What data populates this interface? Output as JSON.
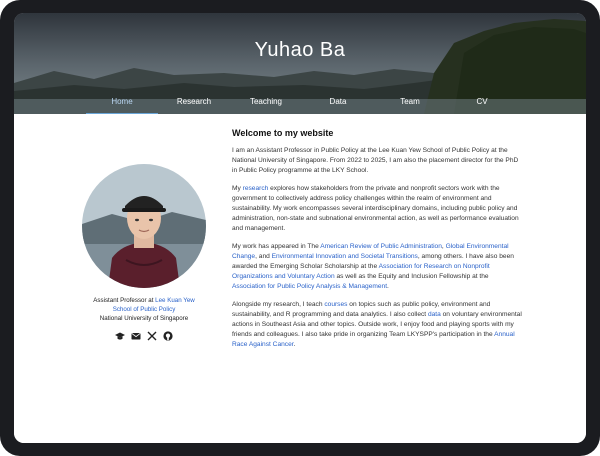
{
  "site": {
    "title": "Yuhao Ba"
  },
  "nav": [
    "Home",
    "Research",
    "Teaching",
    "Data",
    "Team",
    "CV"
  ],
  "sidebar": {
    "line1_prefix": "Assistant Professor at ",
    "line1_link": "Lee Kuan Yew",
    "line2_link": "School of Public Policy",
    "line3": "National University of Singapore",
    "icons": [
      "graduation-cap-icon",
      "email-icon",
      "x-icon",
      "github-icon"
    ]
  },
  "main": {
    "heading": "Welcome to my website",
    "p1": "I am an Assistant Professor in Public Policy at the Lee Kuan Yew School of Public Policy at the National University of Singapore. From 2022 to 2025, I am also the placement director for the PhD in Public Policy programme at the LKY School.",
    "p2a": "My ",
    "p2_link": "research",
    "p2b": " explores how stakeholders from the private and nonprofit sectors work with the government to collectively address policy challenges within the realm of environment and sustainability. My work encompasses several interdisciplinary domains, including public policy and administration, non-state and subnational environmental action, as well as performance evaluation and management.",
    "p3a": "My work has appeared in The ",
    "p3_link1": "American Review of Public Administration",
    "p3b": ", ",
    "p3_link2": "Global Environmental Change",
    "p3c": ", and ",
    "p3_link3": "Environmental Innovation and Societal Transitions",
    "p3d": ", among others. I have also been awarded the Emerging Scholar Scholarship at the ",
    "p3_link4": "Association for Research on Nonprofit Organizations and Voluntary Action",
    "p3e": " as well as the Equity and Inclusion Fellowship at the ",
    "p3_link5": "Association for Public Policy Analysis & Management",
    "p3f": ".",
    "p4a": "Alongside my research, I teach ",
    "p4_link1": "courses",
    "p4b": " on topics such as public policy, environment and sustainability, and R programming and data analytics. I also collect ",
    "p4_link2": "data",
    "p4c": " on voluntary environmental actions in Southeast Asia and other topics. Outside work, I enjoy food and playing sports with my friends and colleagues. I also take pride in organizing Team LKYSPP's participation in the ",
    "p4_link3": "Annual Race Against Cancer",
    "p4d": "."
  }
}
